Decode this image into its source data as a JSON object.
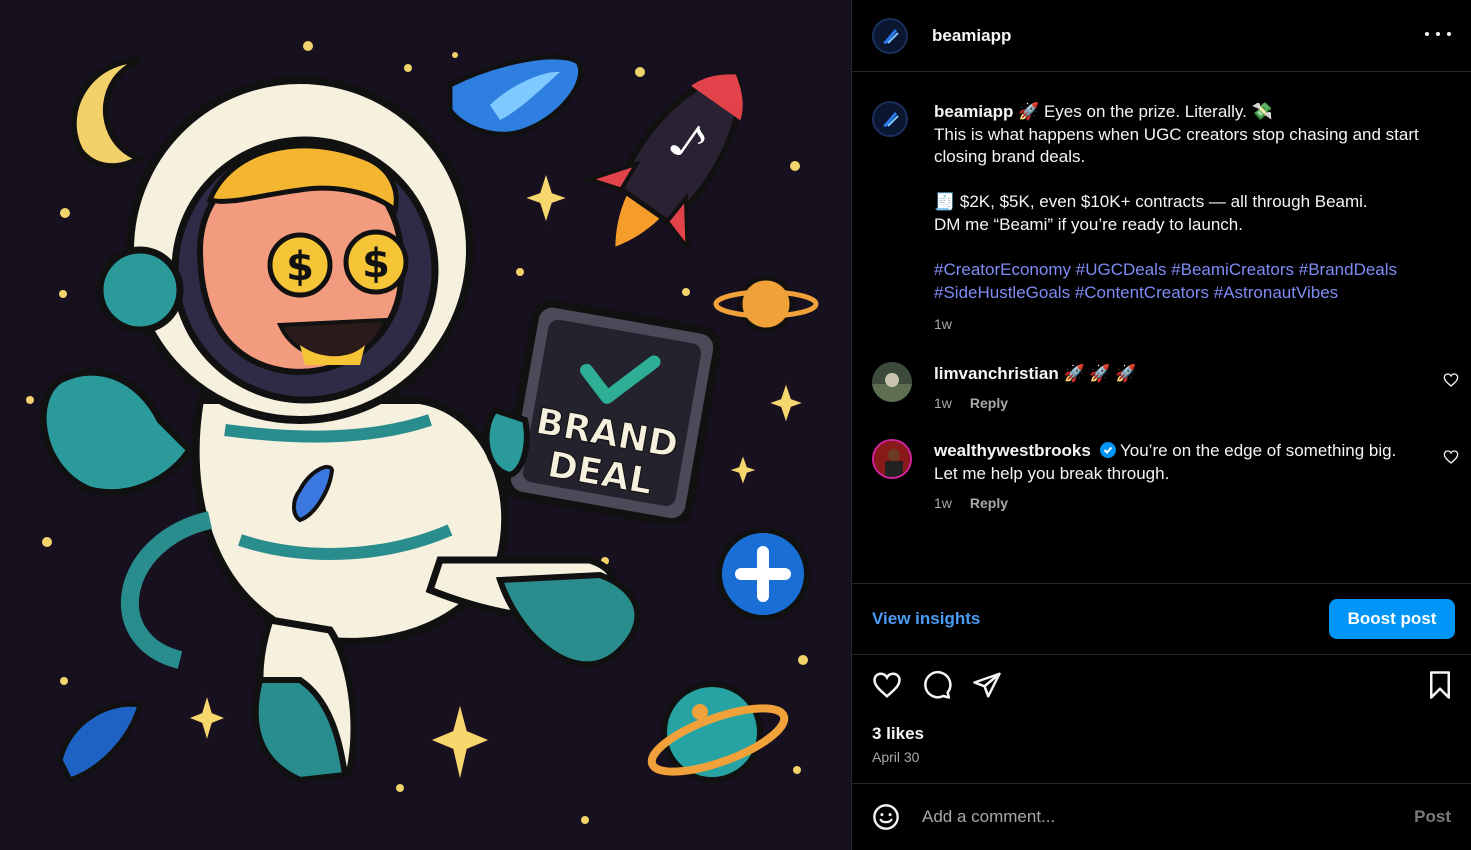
{
  "header": {
    "username": "beamiapp"
  },
  "caption": {
    "username": "beamiapp",
    "line1": " 🚀 Eyes on the prize. Literally. 💸",
    "line2": "This is what happens when UGC creators stop chasing and start closing brand deals.",
    "line3": "🧾 $2K, $5K, even $10K+ contracts — all through Beami.",
    "line4": "DM me “Beami” if you’re ready to launch.",
    "hashtags": [
      "#CreatorEconomy",
      "#UGCDeals",
      "#BeamiCreators",
      "#BrandDeals",
      "#SideHustleGoals",
      "#ContentCreators",
      "#AstronautVibes"
    ],
    "time": "1w"
  },
  "comments": [
    {
      "username": "limvanchristian",
      "text": " 🚀 🚀 🚀",
      "time": "1w",
      "reply": "Reply"
    },
    {
      "username": "wealthywestbrooks",
      "text": " You’re on the edge of something big. Let me help you break through.",
      "time": "1w",
      "reply": "Reply"
    }
  ],
  "insights": {
    "view_label": "View insights",
    "boost_label": "Boost post"
  },
  "post": {
    "likes": "3 likes",
    "date": "April 30"
  },
  "add_comment": {
    "placeholder": "Add a comment...",
    "post_label": "Post"
  },
  "artwork": {
    "sign_line1": "BRAND",
    "sign_line2": "DEAL"
  },
  "colors": {
    "accent": "#0095f6",
    "hashtag": "#7f8cf5",
    "link": "#4a9cf5",
    "background": "#000000",
    "media_bg": "#16101f"
  }
}
